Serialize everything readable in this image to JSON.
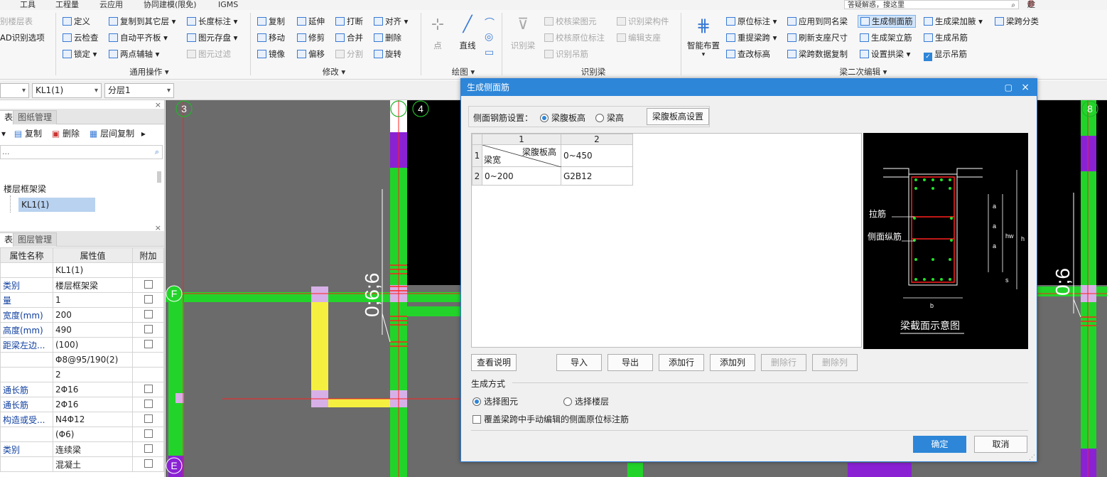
{
  "menubar": {
    "items": [
      "工具",
      "工程量",
      "云应用",
      "协同建模(限免)",
      "IGMS"
    ],
    "search_placeholder": "答疑解惑，搜这里",
    "user": "趁年轻去努力"
  },
  "ribbon": {
    "g0": {
      "items": [
        "别楼层表",
        "AD识别选项"
      ]
    },
    "g1": {
      "items": [
        "定义",
        "云检查",
        "锁定",
        "复制到其它层",
        "自动平齐板",
        "两点辅轴",
        "长度标注",
        "图元存盘",
        "图元过滤"
      ],
      "label": "通用操作"
    },
    "g2": {
      "items": [
        "复制",
        "移动",
        "镜像",
        "延伸",
        "修剪",
        "偏移",
        "打断",
        "合并",
        "分割",
        "对齐",
        "删除",
        "旋转"
      ],
      "label": "修改"
    },
    "g3": {
      "items": [
        "点",
        "直线"
      ],
      "label": "绘图"
    },
    "g4": {
      "items": [
        "识别梁",
        "校核梁图元",
        "校核原位标注",
        "识别吊筋",
        "识别梁构件",
        "编辑支座"
      ],
      "label": "识别梁"
    },
    "g5": {
      "items": [
        "智能布置",
        "原位标注",
        "重提梁跨",
        "查改标高",
        "应用到同名梁",
        "刷新支座尺寸",
        "梁跨数据复制",
        "生成侧面筋",
        "生成架立筋",
        "设置拱梁",
        "生成梁加腋",
        "生成吊筋",
        "显示吊筋",
        "梁跨分类"
      ],
      "label": "梁二次编辑"
    }
  },
  "toolbar2": {
    "combo1": "",
    "combo2": "KL1(1)",
    "combo3": "分层1"
  },
  "left": {
    "tabs_top": [
      "表",
      "图纸管理"
    ],
    "actions": [
      "复制",
      "删除",
      "层间复制"
    ],
    "search_placeholder": "...",
    "tree_parent": "楼层框架梁",
    "tree_selected": "KL1(1)",
    "tabs_bottom": [
      "表",
      "图层管理"
    ],
    "prop_headers": [
      "属性名称",
      "属性值",
      "附加"
    ],
    "props": [
      {
        "name": "",
        "value": "KL1(1)"
      },
      {
        "name": "类别",
        "value": "楼层框架梁"
      },
      {
        "name": "量",
        "value": "1"
      },
      {
        "name": "宽度(mm)",
        "value": "200"
      },
      {
        "name": "高度(mm)",
        "value": "490"
      },
      {
        "name": "距梁左边...",
        "value": "(100)"
      },
      {
        "name": "",
        "value": "Φ8@95/190(2)"
      },
      {
        "name": "",
        "value": "2"
      },
      {
        "name": "通长筋",
        "value": "2Φ16"
      },
      {
        "name": "通长筋",
        "value": "2Φ16"
      },
      {
        "name": "构造或受...",
        "value": "N4Φ12"
      },
      {
        "name": "",
        "value": "(Φ6)"
      },
      {
        "name": "类别",
        "value": "连续梁"
      },
      {
        "name": "",
        "value": "混凝土"
      }
    ]
  },
  "canvas": {
    "axes": [
      "3",
      "4",
      "8",
      "F",
      "E"
    ],
    "beam_labels": [
      "0;6;6",
      "0;6"
    ]
  },
  "dialog": {
    "title": "生成侧面筋",
    "setting_label": "侧面钢筋设置：",
    "radio1": "梁腹板高",
    "radio2": "梁高",
    "setting_button": "梁腹板高设置",
    "col_headers": [
      "1",
      "2"
    ],
    "row_headers": [
      "1",
      "2"
    ],
    "corner_top": "梁腹板高",
    "corner_bottom": "梁宽",
    "cell_r1c2": "0~450",
    "cell_r2c1": "0~200",
    "cell_r2c2": "G2B12",
    "diagram_labels": {
      "tie": "拉筋",
      "side": "侧面纵筋",
      "caption": "梁截面示意图",
      "a": "a",
      "hw": "hw",
      "h": "h",
      "s": "s",
      "b": "b"
    },
    "buttons": [
      "查看说明",
      "导入",
      "导出",
      "添加行",
      "添加列",
      "删除行",
      "删除列"
    ],
    "gen_label": "生成方式",
    "gen_opt1": "选择图元",
    "gen_opt2": "选择楼层",
    "overwrite": "覆盖梁跨中手动编辑的侧面原位标注筋",
    "ok": "确定",
    "cancel": "取消"
  }
}
